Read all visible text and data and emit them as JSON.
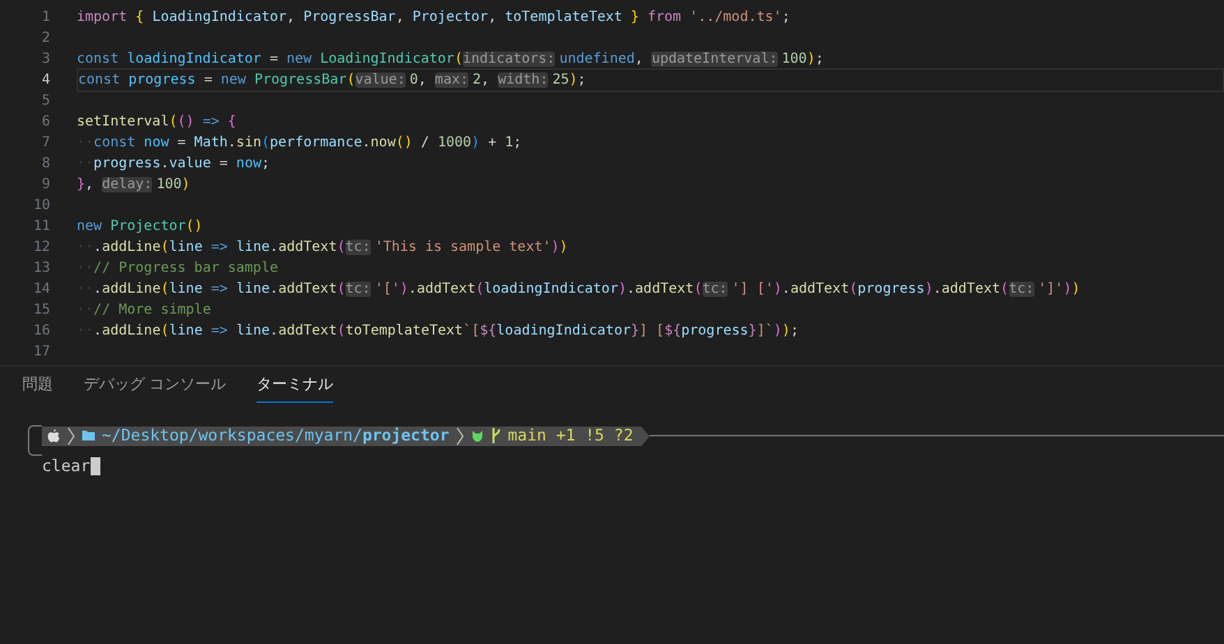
{
  "editor": {
    "lines": [
      {
        "number": "1",
        "active": false,
        "tokens": [
          {
            "kind": "keyword",
            "text": "import "
          },
          {
            "kind": "bracket1",
            "text": "{"
          },
          {
            "kind": "variable",
            "text": " LoadingIndicator"
          },
          {
            "kind": "plain",
            "text": ", "
          },
          {
            "kind": "variable",
            "text": "ProgressBar"
          },
          {
            "kind": "plain",
            "text": ", "
          },
          {
            "kind": "variable",
            "text": "Projector"
          },
          {
            "kind": "plain",
            "text": ", "
          },
          {
            "kind": "variable",
            "text": "toTemplateText "
          },
          {
            "kind": "bracket1",
            "text": "}"
          },
          {
            "kind": "keyword",
            "text": " from "
          },
          {
            "kind": "string",
            "text": "'../mod.ts'"
          },
          {
            "kind": "plain",
            "text": ";"
          }
        ]
      },
      {
        "number": "2",
        "active": false
      },
      {
        "number": "3",
        "active": false,
        "tokens": [
          {
            "kind": "storage",
            "text": "const "
          },
          {
            "kind": "constant",
            "text": "loadingIndicator"
          },
          {
            "kind": "plain",
            "text": " = "
          },
          {
            "kind": "storage",
            "text": "new "
          },
          {
            "kind": "class",
            "text": "LoadingIndicator"
          },
          {
            "kind": "bracket1",
            "text": "("
          },
          {
            "kind": "hint",
            "text": "indicators:"
          },
          {
            "kind": "storage",
            "text": "undefined"
          },
          {
            "kind": "plain",
            "text": ", "
          },
          {
            "kind": "hint",
            "text": "updateInterval:"
          },
          {
            "kind": "number",
            "text": "100"
          },
          {
            "kind": "bracket1",
            "text": ")"
          },
          {
            "kind": "plain",
            "text": ";"
          }
        ]
      },
      {
        "number": "4",
        "active": true,
        "tokens": [
          {
            "kind": "storage",
            "text": "const "
          },
          {
            "kind": "constant",
            "text": "progress"
          },
          {
            "kind": "plain",
            "text": " = "
          },
          {
            "kind": "storage",
            "text": "new "
          },
          {
            "kind": "class",
            "text": "ProgressBar"
          },
          {
            "kind": "bracket1",
            "text": "("
          },
          {
            "kind": "hint",
            "text": "value:"
          },
          {
            "kind": "number",
            "text": "0"
          },
          {
            "kind": "plain",
            "text": ", "
          },
          {
            "kind": "hint",
            "text": "max:"
          },
          {
            "kind": "number",
            "text": "2"
          },
          {
            "kind": "plain",
            "text": ", "
          },
          {
            "kind": "hint",
            "text": "width:"
          },
          {
            "kind": "number",
            "text": "25"
          },
          {
            "kind": "bracket1",
            "text": ")"
          },
          {
            "kind": "plain",
            "text": ";"
          }
        ]
      },
      {
        "number": "5",
        "active": false
      },
      {
        "number": "6",
        "active": false,
        "tokens": [
          {
            "kind": "function",
            "text": "setInterval"
          },
          {
            "kind": "bracket1",
            "text": "("
          },
          {
            "kind": "bracket2",
            "text": "()"
          },
          {
            "kind": "storage",
            "text": " => "
          },
          {
            "kind": "bracket2",
            "text": "{"
          }
        ]
      },
      {
        "number": "7",
        "active": false,
        "tokens": [
          {
            "kind": "whitespace",
            "text": "··"
          },
          {
            "kind": "storage",
            "text": "const "
          },
          {
            "kind": "constant",
            "text": "now"
          },
          {
            "kind": "plain",
            "text": " = "
          },
          {
            "kind": "variable",
            "text": "Math"
          },
          {
            "kind": "plain",
            "text": "."
          },
          {
            "kind": "function",
            "text": "sin"
          },
          {
            "kind": "bracket3",
            "text": "("
          },
          {
            "kind": "variable",
            "text": "performance"
          },
          {
            "kind": "plain",
            "text": "."
          },
          {
            "kind": "function",
            "text": "now"
          },
          {
            "kind": "bracket1",
            "text": "()"
          },
          {
            "kind": "plain",
            "text": " / "
          },
          {
            "kind": "number",
            "text": "1000"
          },
          {
            "kind": "bracket3",
            "text": ")"
          },
          {
            "kind": "plain",
            "text": " + "
          },
          {
            "kind": "number",
            "text": "1"
          },
          {
            "kind": "plain",
            "text": ";"
          }
        ]
      },
      {
        "number": "8",
        "active": false,
        "tokens": [
          {
            "kind": "whitespace",
            "text": "··"
          },
          {
            "kind": "variable",
            "text": "progress"
          },
          {
            "kind": "plain",
            "text": "."
          },
          {
            "kind": "variable",
            "text": "value"
          },
          {
            "kind": "plain",
            "text": " = "
          },
          {
            "kind": "constant",
            "text": "now"
          },
          {
            "kind": "plain",
            "text": ";"
          }
        ]
      },
      {
        "number": "9",
        "active": false,
        "tokens": [
          {
            "kind": "bracket2",
            "text": "}"
          },
          {
            "kind": "plain",
            "text": ", "
          },
          {
            "kind": "hint",
            "text": "delay:"
          },
          {
            "kind": "number",
            "text": "100"
          },
          {
            "kind": "bracket1",
            "text": ")"
          }
        ]
      },
      {
        "number": "10",
        "active": false
      },
      {
        "number": "11",
        "active": false,
        "tokens": [
          {
            "kind": "storage",
            "text": "new "
          },
          {
            "kind": "class",
            "text": "Projector"
          },
          {
            "kind": "bracket1",
            "text": "()"
          }
        ]
      },
      {
        "number": "12",
        "active": false,
        "tokens": [
          {
            "kind": "whitespace",
            "text": "··"
          },
          {
            "kind": "plain",
            "text": "."
          },
          {
            "kind": "function",
            "text": "addLine"
          },
          {
            "kind": "bracket1",
            "text": "("
          },
          {
            "kind": "variable",
            "text": "line"
          },
          {
            "kind": "storage",
            "text": " => "
          },
          {
            "kind": "variable",
            "text": "line"
          },
          {
            "kind": "plain",
            "text": "."
          },
          {
            "kind": "function",
            "text": "addText"
          },
          {
            "kind": "bracket2",
            "text": "("
          },
          {
            "kind": "hint",
            "text": "tc:"
          },
          {
            "kind": "string",
            "text": "'This is sample text'"
          },
          {
            "kind": "bracket2",
            "text": ")"
          },
          {
            "kind": "bracket1",
            "text": ")"
          }
        ]
      },
      {
        "number": "13",
        "active": false,
        "tokens": [
          {
            "kind": "whitespace",
            "text": "··"
          },
          {
            "kind": "comment",
            "text": "// Progress bar sample"
          }
        ]
      },
      {
        "number": "14",
        "active": false,
        "tokens": [
          {
            "kind": "whitespace",
            "text": "··"
          },
          {
            "kind": "plain",
            "text": "."
          },
          {
            "kind": "function",
            "text": "addLine"
          },
          {
            "kind": "bracket1",
            "text": "("
          },
          {
            "kind": "variable",
            "text": "line"
          },
          {
            "kind": "storage",
            "text": " => "
          },
          {
            "kind": "variable",
            "text": "line"
          },
          {
            "kind": "plain",
            "text": "."
          },
          {
            "kind": "function",
            "text": "addText"
          },
          {
            "kind": "bracket2",
            "text": "("
          },
          {
            "kind": "hint",
            "text": "tc:"
          },
          {
            "kind": "string",
            "text": "'['"
          },
          {
            "kind": "bracket2",
            "text": ")"
          },
          {
            "kind": "plain",
            "text": "."
          },
          {
            "kind": "function",
            "text": "addText"
          },
          {
            "kind": "bracket2",
            "text": "("
          },
          {
            "kind": "variable",
            "text": "loadingIndicator"
          },
          {
            "kind": "bracket2",
            "text": ")"
          },
          {
            "kind": "plain",
            "text": "."
          },
          {
            "kind": "function",
            "text": "addText"
          },
          {
            "kind": "bracket2",
            "text": "("
          },
          {
            "kind": "hint",
            "text": "tc:"
          },
          {
            "kind": "string",
            "text": "'] ['"
          },
          {
            "kind": "bracket2",
            "text": ")"
          },
          {
            "kind": "plain",
            "text": "."
          },
          {
            "kind": "function",
            "text": "addText"
          },
          {
            "kind": "bracket2",
            "text": "("
          },
          {
            "kind": "variable",
            "text": "progress"
          },
          {
            "kind": "bracket2",
            "text": ")"
          },
          {
            "kind": "plain",
            "text": "."
          },
          {
            "kind": "function",
            "text": "addText"
          },
          {
            "kind": "bracket2",
            "text": "("
          },
          {
            "kind": "hint",
            "text": "tc:"
          },
          {
            "kind": "string",
            "text": "']'"
          },
          {
            "kind": "bracket2",
            "text": ")"
          },
          {
            "kind": "bracket1",
            "text": ")"
          }
        ]
      },
      {
        "number": "15",
        "active": false,
        "tokens": [
          {
            "kind": "whitespace",
            "text": "··"
          },
          {
            "kind": "comment",
            "text": "// More simple"
          }
        ]
      },
      {
        "number": "16",
        "active": false,
        "tokens": [
          {
            "kind": "whitespace",
            "text": "··"
          },
          {
            "kind": "plain",
            "text": "."
          },
          {
            "kind": "function",
            "text": "addLine"
          },
          {
            "kind": "bracket1",
            "text": "("
          },
          {
            "kind": "variable",
            "text": "line"
          },
          {
            "kind": "storage",
            "text": " => "
          },
          {
            "kind": "variable",
            "text": "line"
          },
          {
            "kind": "plain",
            "text": "."
          },
          {
            "kind": "function",
            "text": "addText"
          },
          {
            "kind": "bracket2",
            "text": "("
          },
          {
            "kind": "function",
            "text": "toTemplateText"
          },
          {
            "kind": "string",
            "text": "`["
          },
          {
            "kind": "keyword",
            "text": "${"
          },
          {
            "kind": "variable",
            "text": "loadingIndicator"
          },
          {
            "kind": "keyword",
            "text": "}"
          },
          {
            "kind": "string",
            "text": "] ["
          },
          {
            "kind": "keyword",
            "text": "${"
          },
          {
            "kind": "variable",
            "text": "progress"
          },
          {
            "kind": "keyword",
            "text": "}"
          },
          {
            "kind": "string",
            "text": "]`"
          },
          {
            "kind": "bracket2",
            "text": ")"
          },
          {
            "kind": "bracket1",
            "text": ")"
          },
          {
            "kind": "plain",
            "text": ";"
          }
        ]
      },
      {
        "number": "17",
        "active": false
      }
    ]
  },
  "panel": {
    "tabs": [
      {
        "label": "問題",
        "selected": false
      },
      {
        "label": "デバッグ コンソール",
        "selected": false
      },
      {
        "label": "ターミナル",
        "selected": true
      }
    ],
    "terminal": {
      "path": "~/Desktop/workspaces/myarn/**projector**",
      "git_status": "main +1 !5 ?2",
      "command": "clear"
    }
  }
}
